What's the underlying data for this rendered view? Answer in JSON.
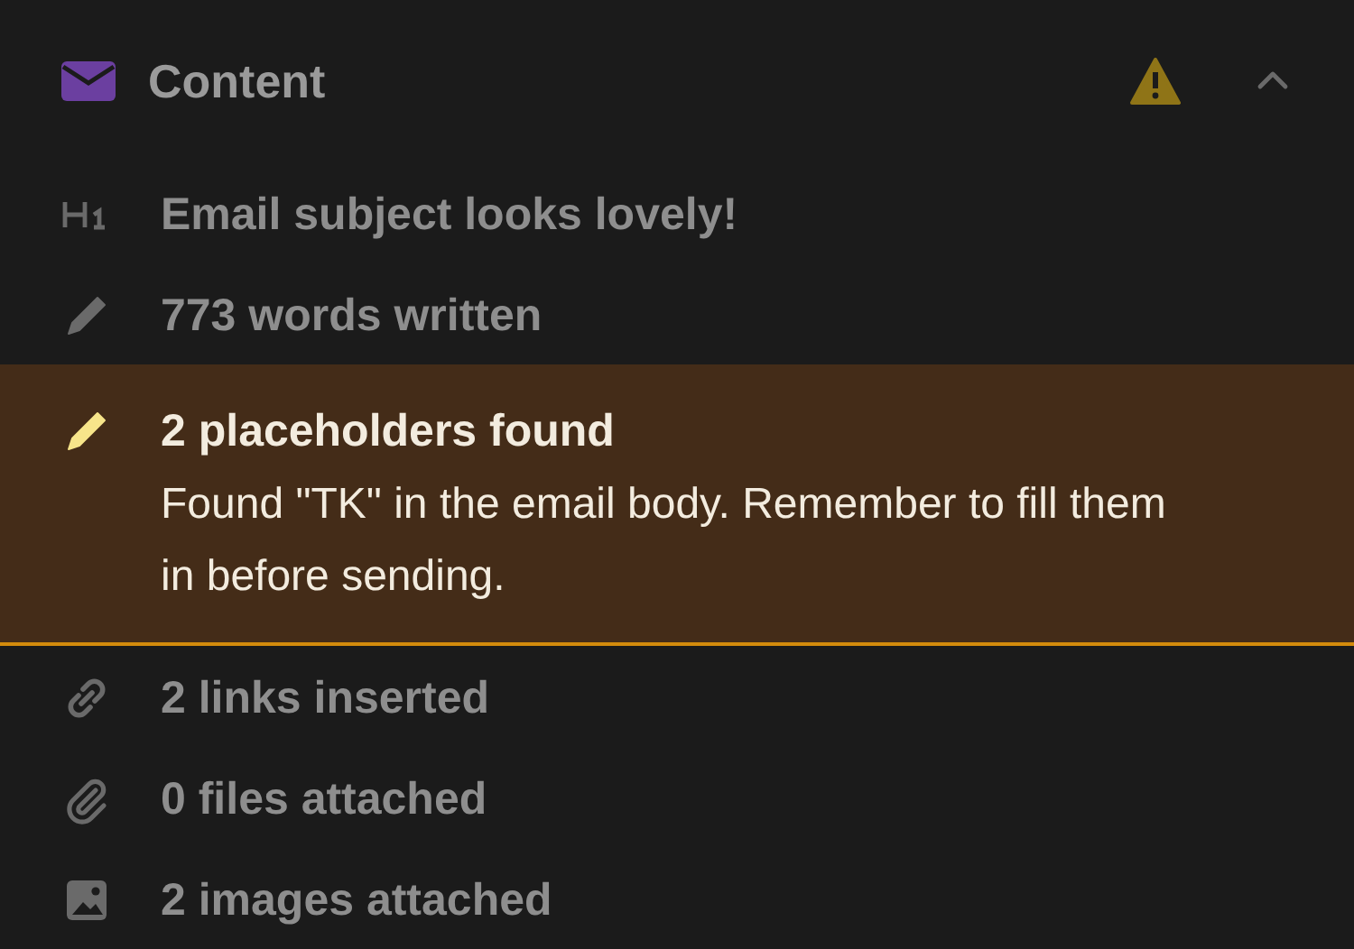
{
  "section": {
    "title": "Content",
    "warning": true,
    "expanded": true
  },
  "items": [
    {
      "kind": "heading",
      "title": "Email subject looks lovely!",
      "warning": false
    },
    {
      "kind": "pencil",
      "title": "773 words written",
      "warning": false
    },
    {
      "kind": "pencil",
      "title": "2 placeholders found",
      "warning": true,
      "description": "Found \"TK\" in the email body. Remember to fill them in before sending."
    },
    {
      "kind": "link",
      "title": "2 links inserted",
      "warning": false
    },
    {
      "kind": "clip",
      "title": "0 files attached",
      "warning": false
    },
    {
      "kind": "image",
      "title": "2 images attached",
      "warning": false
    }
  ]
}
